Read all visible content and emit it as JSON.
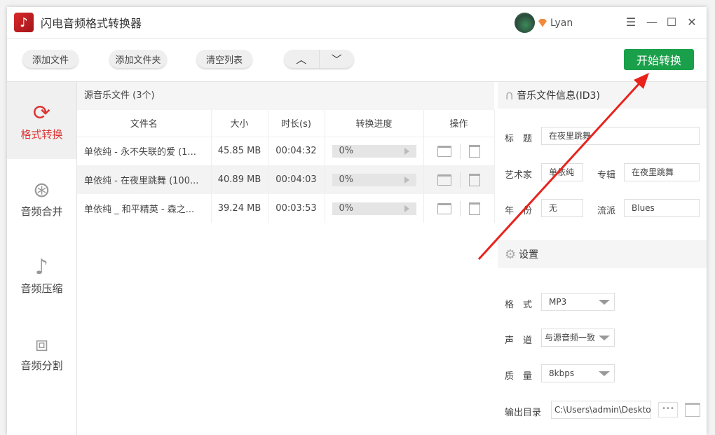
{
  "app": {
    "title": "闪电音频格式转换器",
    "user": "Lyan"
  },
  "toolbar": {
    "add_file": "添加文件",
    "add_folder": "添加文件夹",
    "clear_list": "清空列表",
    "up": "︿",
    "down": "﹀",
    "start": "开始转换"
  },
  "sidebar": {
    "items": [
      {
        "label": "格式转换",
        "icon": "⟳"
      },
      {
        "label": "音频合并",
        "icon": "⊛"
      },
      {
        "label": "音频压缩",
        "icon": "♪"
      },
      {
        "label": "音频分割",
        "icon": "⧈"
      }
    ]
  },
  "files": {
    "header": "源音乐文件 (3个)",
    "columns": [
      "文件名",
      "大小",
      "时长(s)",
      "转换进度",
      "操作"
    ],
    "rows": [
      {
        "name": "单依纯 - 永不失联的爱 (1...",
        "size": "45.85 MB",
        "duration": "00:04:32",
        "progress": "0%"
      },
      {
        "name": "单依纯 - 在夜里跳舞 (100...",
        "size": "40.89 MB",
        "duration": "00:04:03",
        "progress": "0%"
      },
      {
        "name": "单依纯 _ 和平精英 - 森之...",
        "size": "39.24 MB",
        "duration": "00:03:53",
        "progress": "0%"
      }
    ]
  },
  "id3": {
    "header": "音乐文件信息(ID3)",
    "title_label": "标　题",
    "title": "在夜里跳舞",
    "artist_label": "艺术家",
    "artist": "单依纯",
    "album_label": "专辑",
    "album": "在夜里跳舞",
    "year_label": "年　份",
    "year": "无",
    "genre_label": "流派",
    "genre": "Blues"
  },
  "settings": {
    "header": "设置",
    "format_label": "格　式",
    "format": "MP3",
    "channel_label": "声　道",
    "channel": "与源音频一致",
    "quality_label": "质　量",
    "quality": "8kbps",
    "output_label": "输出目录",
    "output": "C:\\Users\\admin\\Desktop",
    "browse": "•••"
  },
  "colors": {
    "accent": "#d33333",
    "start": "#1aa04a",
    "arrow": "#e8231c"
  }
}
